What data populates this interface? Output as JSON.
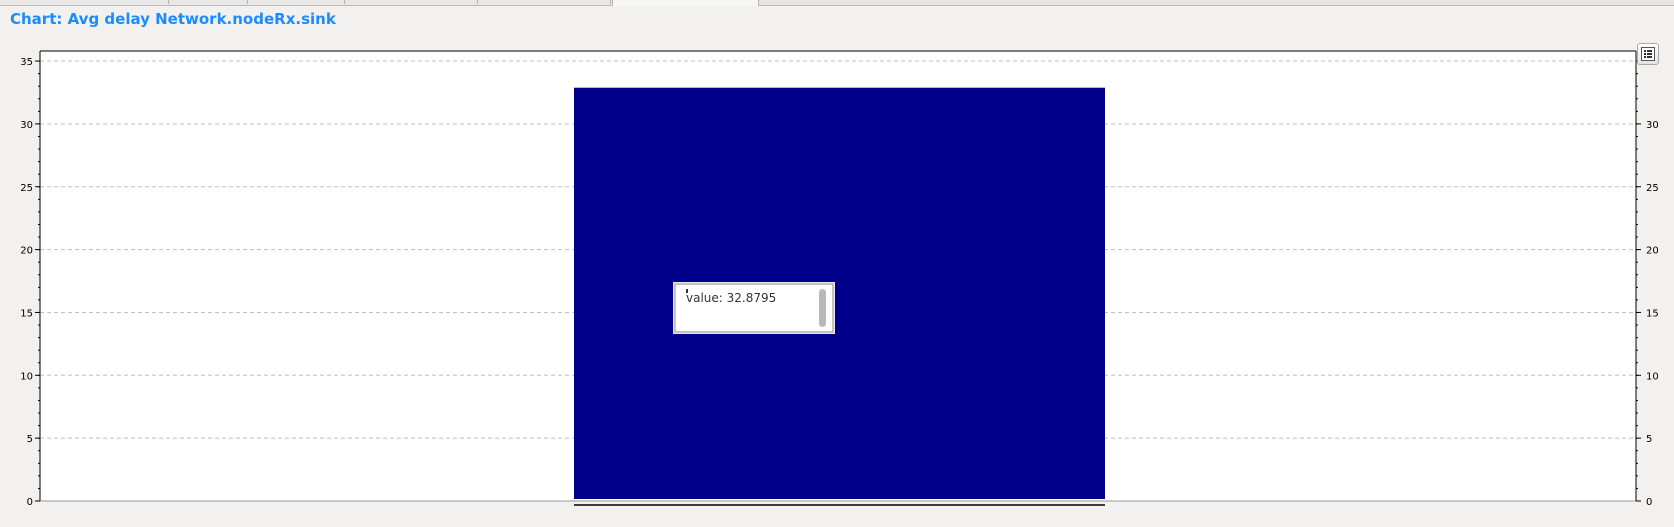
{
  "page": {
    "title": "Chart: Avg delay Network.nodeRx.sink"
  },
  "chart_data": {
    "type": "bar",
    "categories": [
      ""
    ],
    "values": [
      32.8795
    ],
    "title": "Chart: Avg delay Network.nodeRx.sink",
    "xlabel": "",
    "ylabel": "",
    "ylim": [
      0,
      35
    ],
    "yticks": [
      "0",
      "5",
      "10",
      "15",
      "20",
      "25",
      "30",
      "35"
    ],
    "grid": true,
    "bar_color": "#00008b",
    "grid_color": "#c0c0c0"
  },
  "tooltip": {
    "text": "value: 32.8795"
  },
  "legend_button": {
    "icon": "legend-list-icon"
  }
}
